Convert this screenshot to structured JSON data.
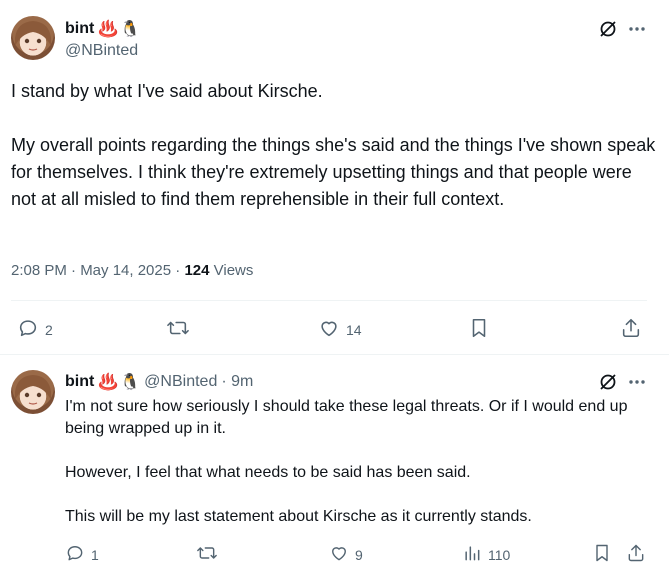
{
  "main_tweet": {
    "display_name": "bint",
    "name_emoji": [
      "♨️",
      "🐧"
    ],
    "handle": "@NBinted",
    "paragraphs": [
      "I stand by what I've said about Kirsche.",
      "My overall points regarding the things she's said and the things I've shown speak for themselves. I think they're extremely upsetting things and that people were not at all misled to find them reprehensible in their full context."
    ],
    "timestamp": "2:08 PM · May 14, 2025",
    "separator": "·",
    "views_count": "124",
    "views_label": "Views",
    "replies": "2",
    "likes": "14"
  },
  "reply_tweet": {
    "display_name": "bint",
    "name_emoji": [
      "♨️",
      "🐧"
    ],
    "handle": "@NBinted",
    "age": "· 9m",
    "paragraphs": [
      "I'm not sure how seriously I should take these legal threats. Or if I would end up being wrapped up in it.",
      "However, I feel that what needs to be said has been said.",
      "This will be my last statement about Kirsche as it currently stands."
    ],
    "replies": "1",
    "likes": "9",
    "views": "110"
  },
  "icons": {
    "grok": "grok-icon",
    "more": "more-icon",
    "reply": "reply-icon",
    "repost": "repost-icon",
    "like": "like-icon",
    "bookmark": "bookmark-icon",
    "share": "share-icon",
    "views": "views-icon"
  },
  "colors": {
    "text": "#0f1419",
    "secondary": "#536471",
    "divider": "#eff3f4"
  }
}
